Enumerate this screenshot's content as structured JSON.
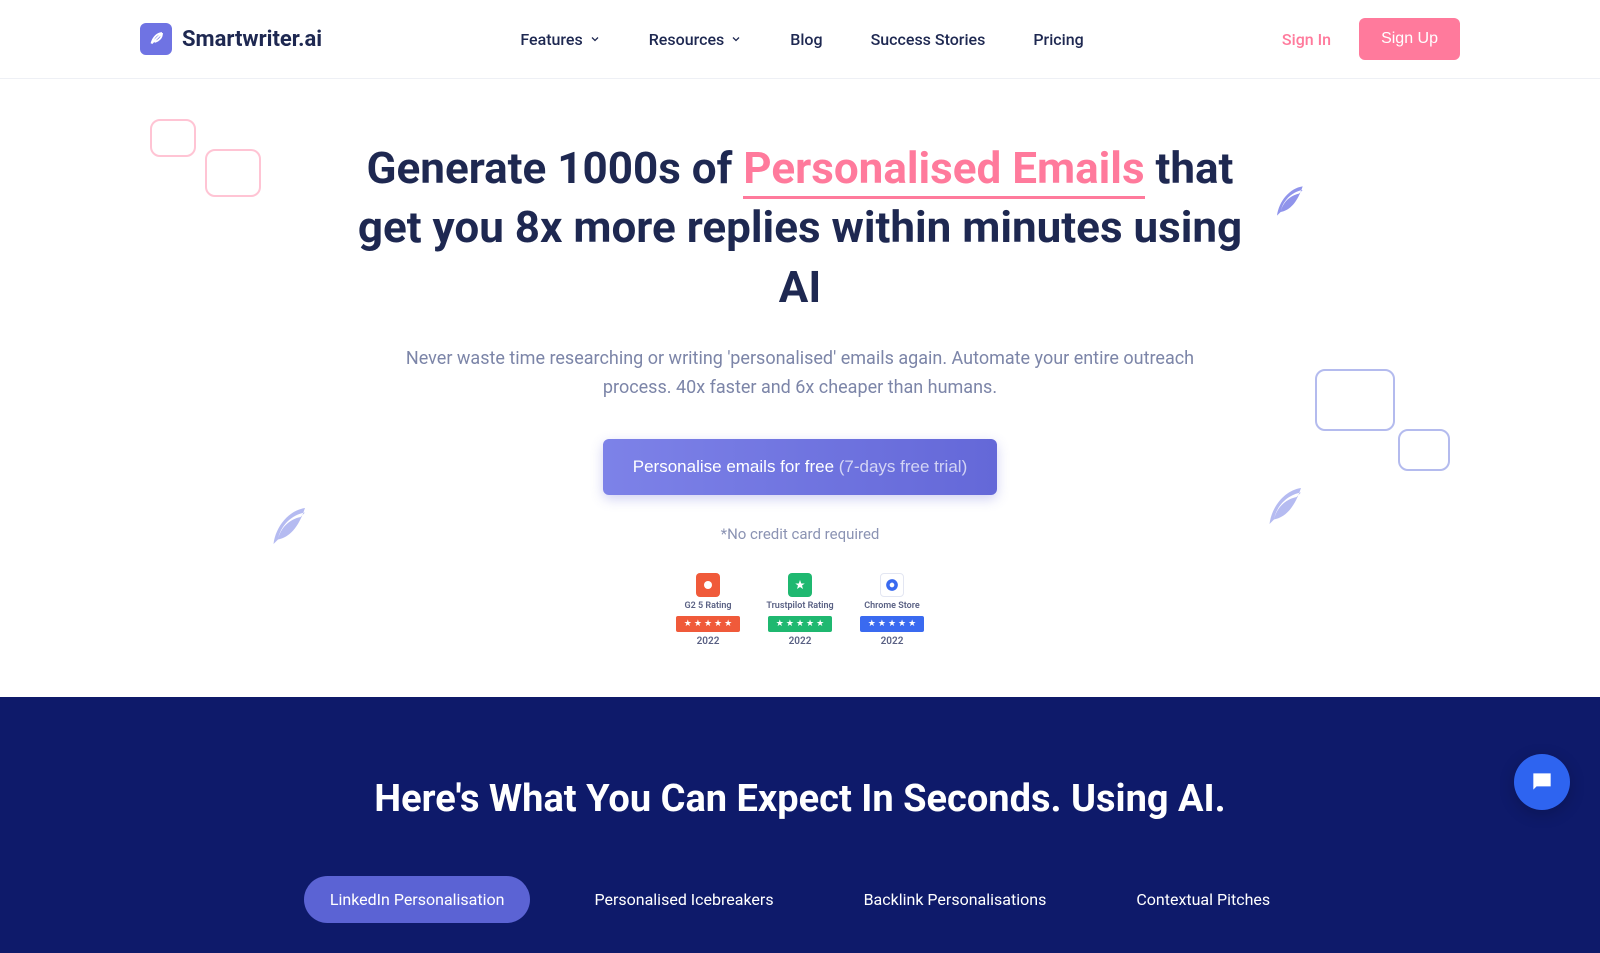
{
  "brand": {
    "name": "Smartwriter.ai"
  },
  "nav": {
    "items": [
      {
        "label": "Features",
        "dropdown": true
      },
      {
        "label": "Resources",
        "dropdown": true
      },
      {
        "label": "Blog",
        "dropdown": false
      },
      {
        "label": "Success Stories",
        "dropdown": false
      },
      {
        "label": "Pricing",
        "dropdown": false
      }
    ]
  },
  "auth": {
    "signin": "Sign In",
    "signup": "Sign Up"
  },
  "hero": {
    "h1_pre": "Generate 1000s of ",
    "h1_highlight": "Personalised Emails",
    "h1_post": " that get you 8x more replies within minutes using AI",
    "sub": "Never waste time researching or writing 'personalised' emails again. Automate your entire outreach process. 40x faster and 6x cheaper than humans.",
    "cta_main": "Personalise emails for free ",
    "cta_trial": "(7-days free trial)",
    "nocc": "*No credit card required"
  },
  "badges": [
    {
      "name": "G2 5 Rating",
      "color": "#f05a3a",
      "year": "2022"
    },
    {
      "name": "Trustpilot Rating",
      "color": "#1fb870",
      "year": "2022"
    },
    {
      "name": "Chrome Store",
      "color": "#3a6af0",
      "year": "2022"
    }
  ],
  "dark": {
    "heading": "Here's What You Can Expect In Seconds. Using AI.",
    "tabs": [
      {
        "label": "LinkedIn Personalisation",
        "active": true
      },
      {
        "label": "Personalised Icebreakers",
        "active": false
      },
      {
        "label": "Backlink Personalisations",
        "active": false
      },
      {
        "label": "Contextual Pitches",
        "active": false
      }
    ]
  }
}
